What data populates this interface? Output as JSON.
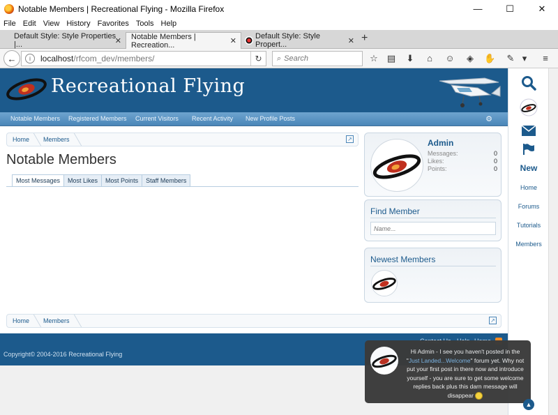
{
  "window": {
    "title": "Notable Members | Recreational Flying - Mozilla Firefox",
    "minimize": "—",
    "maximize": "☐",
    "close": "✕"
  },
  "menu": [
    "File",
    "Edit",
    "View",
    "History",
    "Favorites",
    "Tools",
    "Help"
  ],
  "tabs": [
    {
      "label": "Default Style: Style Properties |..."
    },
    {
      "label": "Notable Members | Recreation..."
    },
    {
      "label": "Default Style: Style Propert..."
    }
  ],
  "newtab": "+",
  "address": {
    "host": "localhost",
    "path": "/rfcom_dev/members/"
  },
  "search": {
    "placeholder": "Search"
  },
  "site": {
    "title": "Recreational Flying"
  },
  "nav": [
    "Notable Members",
    "Registered Members",
    "Current Visitors",
    "Recent Activity",
    "New Profile Posts"
  ],
  "breadcrumb": [
    "Home",
    "Members"
  ],
  "page_title": "Notable Members",
  "member_tabs": [
    "Most Messages",
    "Most Likes",
    "Most Points",
    "Staff Members"
  ],
  "visitor": {
    "name": "Admin",
    "stats": [
      {
        "label": "Messages:",
        "value": "0"
      },
      {
        "label": "Likes:",
        "value": "0"
      },
      {
        "label": "Points:",
        "value": "0"
      }
    ]
  },
  "find_member": {
    "title": "Find Member",
    "placeholder": "Name..."
  },
  "newest_members": {
    "title": "Newest Members"
  },
  "footer": {
    "links": [
      "Contact Us",
      "Help",
      "Home"
    ],
    "copyright": "Copyright© 2004-2016 Recreational Flying"
  },
  "sidebar": [
    "Home",
    "Forums",
    "Tutorials",
    "Members"
  ],
  "sidebar_new": "New",
  "notice": {
    "text1": "Hi Admin - I see you haven't posted in the \"",
    "link": "Just Landed...Welcome",
    "text2": "\" forum yet. Why not put your first post in there now and introduce yourself - you are sure to get some welcome replies back plus this darn message will disappear"
  },
  "colors": {
    "brand": "#1c5a8c",
    "nav": "#4a86b8"
  }
}
